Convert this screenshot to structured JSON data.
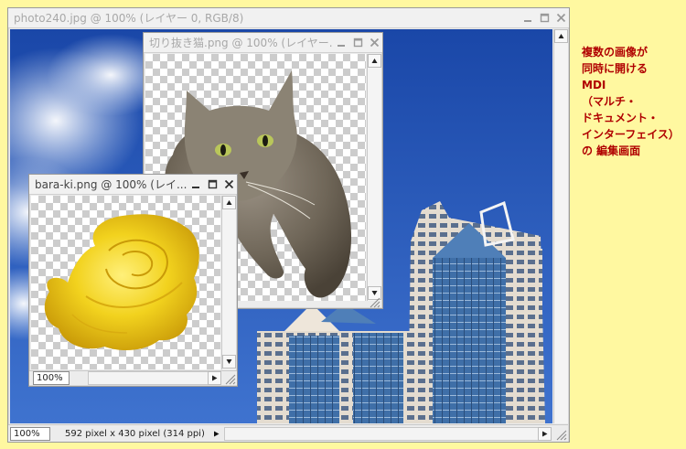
{
  "main_window": {
    "title": "photo240.jpg @ 100% (レイヤー 0, RGB/8)",
    "zoom": "100%",
    "status": "592 pixel x 430 pixel (314 ppi)"
  },
  "cat_window": {
    "title": "切り抜き猫.png @ 100% (レイヤー..."
  },
  "rose_window": {
    "title": "bara-ki.png @ 100% (レイ...",
    "zoom": "100%"
  },
  "note": {
    "lines": [
      "複数の画像が",
      "同時に開ける",
      "MDI",
      "（マルチ・",
      "ドキュメント・",
      "インターフェイス）",
      "の 編集画面"
    ]
  },
  "colors": {
    "background": "#fff8a0",
    "note_text": "#b00000",
    "sky": "#1f4fb0",
    "rose": "#f2d21e"
  },
  "icons": [
    "minimize-icon",
    "maximize-icon",
    "close-icon",
    "scroll-up-icon",
    "scroll-down-icon",
    "scroll-right-icon",
    "resize-grip-icon"
  ]
}
